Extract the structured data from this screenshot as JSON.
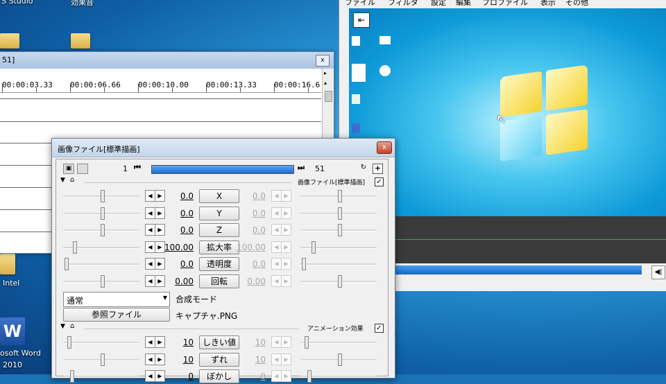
{
  "desktop": {
    "top_labels": [
      "S Studio",
      "効果音"
    ],
    "bottom_labels": [
      "Intel",
      "osoft Word",
      "2010"
    ]
  },
  "timeline": {
    "title": "51]",
    "close": "x",
    "times": [
      "00:00:03.33",
      "00:00:06.66",
      "00:00:10.00",
      "00:00:13.33",
      "00:00:16.6"
    ]
  },
  "preview": {
    "menu": [
      "ファイル",
      "フィルタ",
      "設定",
      "編集",
      "プロファイル",
      "表示",
      "その他"
    ]
  },
  "dialog": {
    "title": "画像ファイル[標準描画]",
    "close": "x",
    "frame_start": "1",
    "frame_end": "51",
    "frame_progress": 1.0,
    "section1": {
      "label": "画像ファイル[標準描画]",
      "checked": true
    },
    "params": [
      {
        "label": "X",
        "value": "0.0",
        "value2": "0.0"
      },
      {
        "label": "Y",
        "value": "0.0",
        "value2": "0.0"
      },
      {
        "label": "Z",
        "value": "0.0",
        "value2": "0.0"
      },
      {
        "label": "拡大率",
        "value": "100.00",
        "value2": "100.00"
      },
      {
        "label": "透明度",
        "value": "0.0",
        "value2": "0.0"
      },
      {
        "label": "回転",
        "value": "0.00",
        "value2": "0.00"
      }
    ],
    "blend_select": "通常",
    "blend_label": "合成モード",
    "ref_file_button": "参照ファイル",
    "file_name": "キャプチャ.PNG",
    "section2": {
      "label": "アニメーション効果",
      "checked": true
    },
    "anim_params": [
      {
        "label": "しきい値",
        "value": "10",
        "value2": "10"
      },
      {
        "label": "ずれ",
        "value": "10",
        "value2": "10"
      },
      {
        "label": "ぼかし",
        "value": "0",
        "value2": "0"
      }
    ]
  },
  "icons": {
    "rewind": "⏮",
    "forward": "⏭",
    "check": "✓"
  }
}
